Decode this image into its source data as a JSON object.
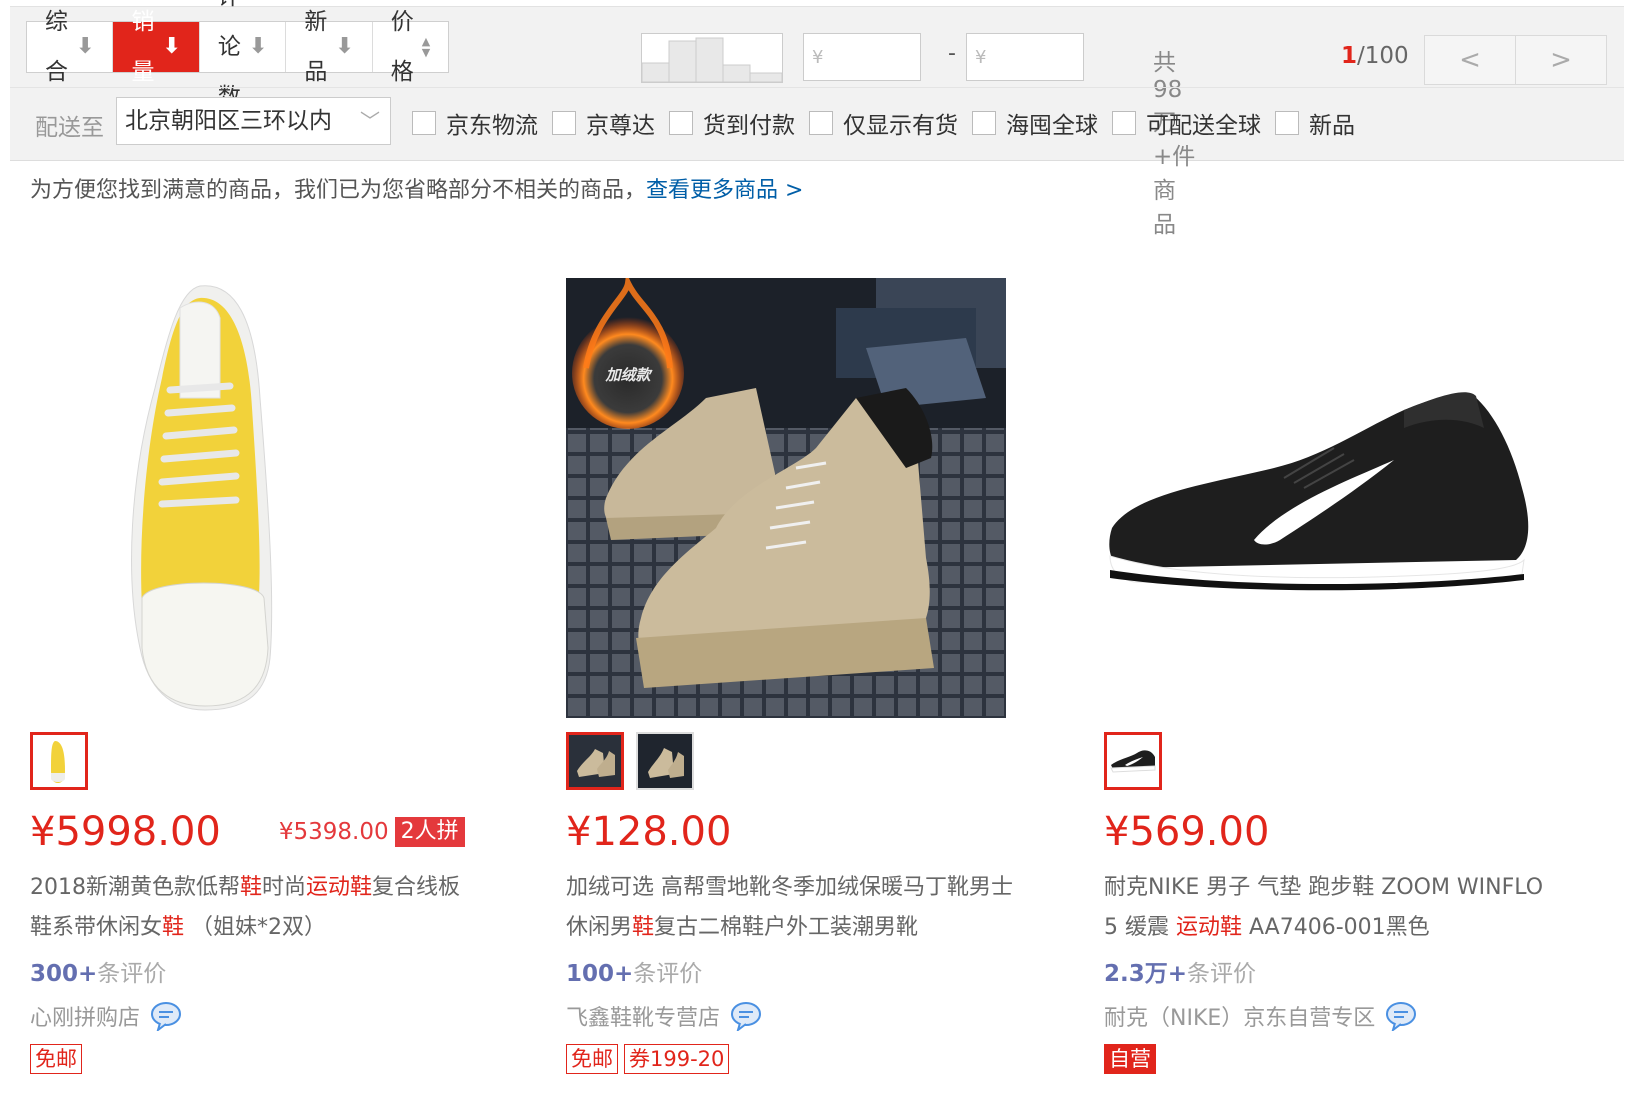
{
  "sort_bar": {
    "options": [
      {
        "label": "综合",
        "arrow": "⬇"
      },
      {
        "label": "销量",
        "arrow": "⬇"
      },
      {
        "label": "评论数",
        "arrow": "⬇"
      },
      {
        "label": "新品",
        "arrow": "⬇"
      },
      {
        "label": "价格",
        "arrow": "updown"
      }
    ],
    "active": "销量"
  },
  "price_filter": {
    "min_placeholder": "¥",
    "max_placeholder": "¥",
    "separator": "-"
  },
  "results": {
    "total": "共98万+件商品",
    "current_page": "1",
    "total_pages": "/100",
    "prev": "<",
    "next": ">"
  },
  "shipping": {
    "label": "配送至",
    "region": "北京朝阳区三环以内"
  },
  "filters": [
    "京东物流",
    "京尊达",
    "货到付款",
    "仅显示有货",
    "海囤全球",
    "可配送全球",
    "新品"
  ],
  "notice": {
    "text": "为方便您找到满意的商品，我们已为您省略部分不相关的商品，",
    "link": "查看更多商品 >"
  },
  "products": [
    {
      "price": "¥5998.00",
      "group_price": "¥5398.00",
      "group_badge": "2人拼",
      "title_parts": [
        {
          "t": "2018新潮黄色款低帮",
          "h": false
        },
        {
          "t": "鞋",
          "h": true
        },
        {
          "t": "时尚",
          "h": false
        },
        {
          "t": "运动鞋",
          "h": true
        },
        {
          "t": "复合线板鞋系带休闲女",
          "h": false
        },
        {
          "t": "鞋",
          "h": true
        },
        {
          "t": " （姐妹*2双）",
          "h": false
        }
      ],
      "reviews_count": "300+",
      "reviews_suffix": "条评价",
      "shop": "心刚拼购店",
      "tags": [
        {
          "label": "免邮",
          "solid": false
        }
      ]
    },
    {
      "price": "¥128.00",
      "image_badge": "加绒款",
      "title_parts": [
        {
          "t": "加绒可选 高帮雪地靴冬季加绒保暖马丁靴男士休闲男",
          "h": false
        },
        {
          "t": "鞋",
          "h": true
        },
        {
          "t": "复古二棉鞋户外工装潮男靴",
          "h": false
        }
      ],
      "reviews_count": "100+",
      "reviews_suffix": "条评价",
      "shop": "飞鑫鞋靴专营店",
      "tags": [
        {
          "label": "免邮",
          "solid": false
        },
        {
          "label": "券199-20",
          "solid": false
        }
      ]
    },
    {
      "price": "¥569.00",
      "title_parts": [
        {
          "t": "耐克NIKE 男子 气垫 跑步鞋 ZOOM WINFLO 5 缓震 ",
          "h": false
        },
        {
          "t": "运动鞋",
          "h": true
        },
        {
          "t": " AA7406-001黑色",
          "h": false
        }
      ],
      "reviews_count": "2.3万+",
      "reviews_suffix": "条评价",
      "shop": "耐克（NIKE）京东自营专区",
      "tags": [
        {
          "label": "自营",
          "solid": true
        }
      ]
    }
  ],
  "colors": {
    "accent": "#e1251b",
    "link": "#005ea7",
    "review": "#646fb0"
  }
}
